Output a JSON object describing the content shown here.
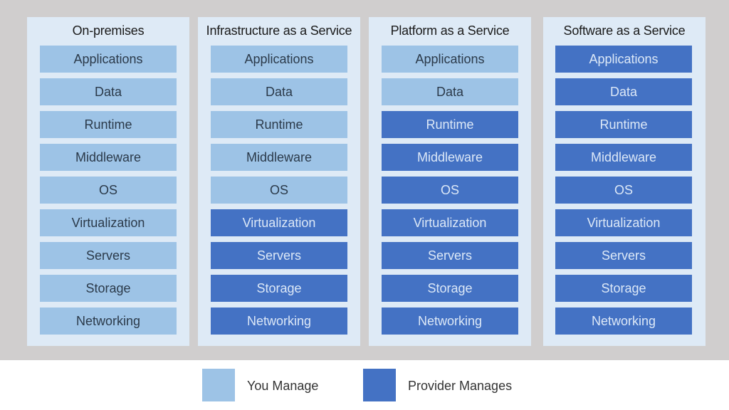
{
  "colors": {
    "you_manage": "#9dc3e6",
    "provider_manages": "#4472c4",
    "panel_bg": "#deeaf6",
    "background": "#d0cece"
  },
  "columns": [
    {
      "title": "On-premises",
      "provider_from_index": 9
    },
    {
      "title": "Infrastructure as a Service",
      "provider_from_index": 5
    },
    {
      "title": "Platform as a Service",
      "provider_from_index": 2
    },
    {
      "title": "Software as a Service",
      "provider_from_index": 0
    }
  ],
  "layers": [
    "Applications",
    "Data",
    "Runtime",
    "Middleware",
    "OS",
    "Virtualization",
    "Servers",
    "Storage",
    "Networking"
  ],
  "legend": [
    {
      "label": "You Manage",
      "kind": "you"
    },
    {
      "label": "Provider Manages",
      "kind": "provider"
    }
  ]
}
